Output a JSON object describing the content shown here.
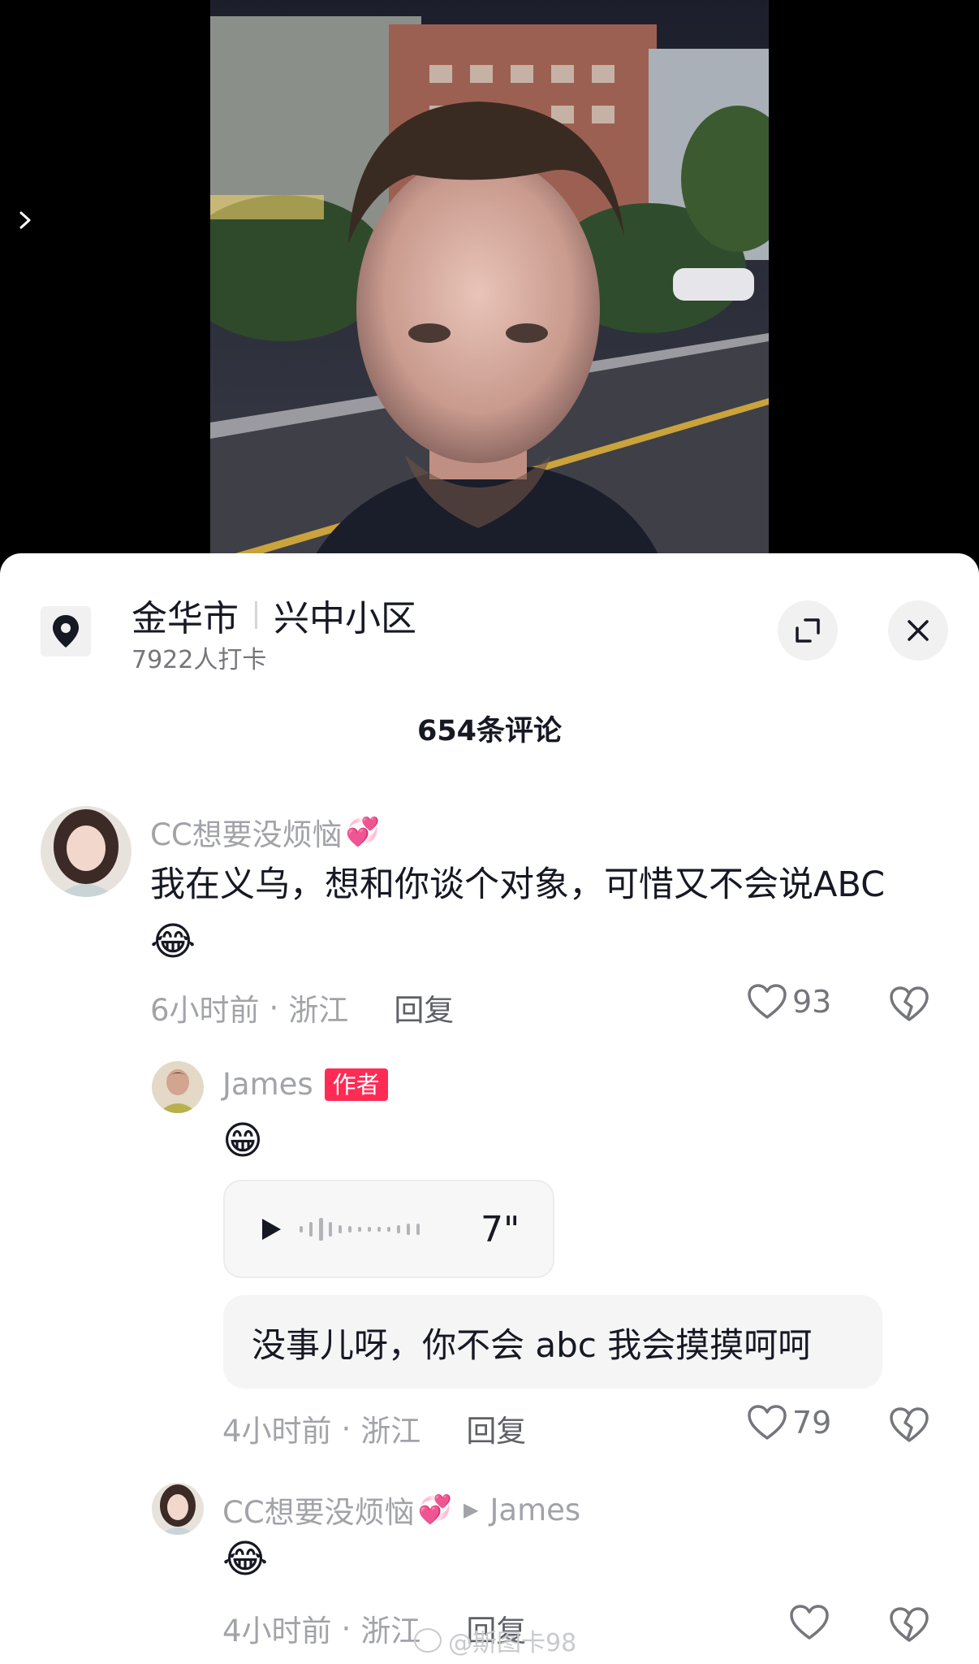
{
  "location": {
    "city": "金华市",
    "place": "兴中小区",
    "checkins": "7922人打卡"
  },
  "comments_header": {
    "count_label": "654条评论"
  },
  "comments": [
    {
      "username": "CC想要没烦恼",
      "username_emoji": "💞",
      "text": "我在义乌，想和你谈个对象，可惜又不会说ABC",
      "emoji": "😂",
      "time": "6小时前",
      "region": "浙江",
      "reply_label": "回复",
      "likes": "93"
    }
  ],
  "replies": [
    {
      "username": "James",
      "badge": "作者",
      "emoji": "😁",
      "voice_duration": "7\"",
      "text": "没事儿呀，你不会 abc 我会摸摸呵呵",
      "time": "4小时前",
      "region": "浙江",
      "reply_label": "回复",
      "likes": "79"
    },
    {
      "username": "CC想要没烦恼",
      "username_emoji": "💞",
      "reply_to": "James",
      "emoji": "😂",
      "time": "4小时前",
      "region": "浙江",
      "reply_label": "回复"
    }
  ],
  "watermark": "@斯图卡98",
  "colors": {
    "badge": "#fe2c55",
    "muted_text": "#a2a3a8",
    "primary_text": "#161823"
  }
}
